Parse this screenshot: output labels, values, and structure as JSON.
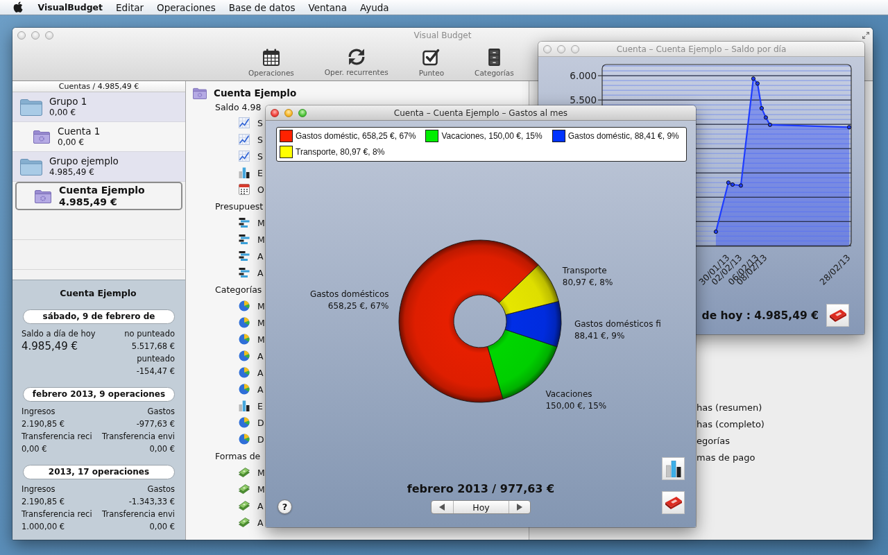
{
  "menu_bar": {
    "app_name": "VisualBudget",
    "items": [
      "Editar",
      "Operaciones",
      "Base de datos",
      "Ventana",
      "Ayuda"
    ]
  },
  "main_window": {
    "title": "Visual Budget",
    "active": false,
    "toolbar": [
      {
        "label": "Operaciones",
        "kind": "calendar"
      },
      {
        "label": "Oper. recurrentes",
        "kind": "repeat"
      },
      {
        "label": "Punteo",
        "kind": "check"
      },
      {
        "label": "Categorías",
        "kind": "cabinet"
      }
    ],
    "sidebar": {
      "header": "Cuentas / 4.985,49 €",
      "tree": [
        {
          "kind": "group",
          "name": "Grupo 1",
          "amount": "0,00 €",
          "selected": false,
          "children": [
            {
              "kind": "account",
              "name": "Cuenta 1",
              "amount": "0,00 €",
              "selected": false
            }
          ]
        },
        {
          "kind": "group",
          "name": "Grupo ejemplo",
          "amount": "4.985,49 €",
          "selected": false,
          "children": [
            {
              "kind": "account",
              "name": "Cuenta Ejemplo",
              "amount": "4.985,49 €",
              "selected": true
            }
          ]
        }
      ],
      "summary": {
        "title": "Cuenta Ejemplo",
        "sections": [
          {
            "kind": "balance",
            "heading": "sábado, 9 de febrero de",
            "label": "Saldo a día de hoy",
            "value": "4.985,49 €",
            "figures": [
              {
                "label": "no punteado",
                "value": "5.517,68 €"
              },
              {
                "label": "punteado",
                "value": "-154,47 €"
              }
            ]
          },
          {
            "kind": "totals",
            "heading": "febrero 2013, 9 operaciones",
            "figures": [
              {
                "label": "Ingresos",
                "value": "2.190,85 €"
              },
              {
                "label": "Gastos",
                "value": "-977,63 €"
              },
              {
                "label": "Transferencia reci",
                "value": "0,00 €"
              },
              {
                "label": "Transferencia envi",
                "value": "0,00 €"
              }
            ]
          },
          {
            "kind": "totals",
            "heading": "2013, 17 operaciones",
            "figures": [
              {
                "label": "Ingresos",
                "value": "2.190,85 €"
              },
              {
                "label": "Gastos",
                "value": "-1.343,33 €"
              },
              {
                "label": "Transferencia reci",
                "value": "1.000,00 €"
              },
              {
                "label": "Transferencia envi",
                "value": "0,00 €"
              }
            ]
          }
        ]
      }
    },
    "detail": {
      "title": "Cuenta Ejemplo",
      "balance": "Saldo 4.98",
      "items": [
        {
          "kind": "line-chart",
          "label": "S"
        },
        {
          "kind": "line-chart",
          "label": "S"
        },
        {
          "kind": "line-chart",
          "label": "S"
        },
        {
          "kind": "bar-chart",
          "label": "E"
        },
        {
          "kind": "calendar",
          "label": "O"
        }
      ],
      "sections": [
        {
          "heading": "Presupuest",
          "items": [
            {
              "kind": "budget",
              "label": "M"
            },
            {
              "kind": "budget",
              "label": "M"
            },
            {
              "kind": "budget",
              "label": "A"
            },
            {
              "kind": "budget",
              "label": "A"
            }
          ]
        },
        {
          "heading": "Categorías",
          "items": [
            {
              "kind": "pie",
              "label": "M"
            },
            {
              "kind": "pie",
              "label": "M"
            },
            {
              "kind": "pie",
              "label": "M"
            },
            {
              "kind": "pie",
              "label": "A"
            },
            {
              "kind": "pie",
              "label": "A"
            },
            {
              "kind": "pie",
              "label": "A"
            },
            {
              "kind": "bar-chart",
              "label": "E"
            },
            {
              "kind": "pie",
              "label": "D"
            },
            {
              "kind": "pie",
              "label": "D"
            }
          ]
        },
        {
          "heading": "Formas de",
          "items": [
            {
              "kind": "money",
              "label": "M"
            },
            {
              "kind": "money",
              "label": "M"
            },
            {
              "kind": "money",
              "label": "A"
            },
            {
              "kind": "money",
              "label": "A"
            }
          ]
        }
      ]
    },
    "reports": {
      "items": [
        "has (resumen)",
        "has (completo)",
        "egorías",
        "mas de pago"
      ]
    }
  },
  "chart_window": {
    "title": "Cuenta – Cuenta Ejemplo – Saldo por día",
    "active": false,
    "chart_data": {
      "type": "area",
      "categories": [
        null,
        null,
        null,
        null,
        null,
        null,
        null,
        null,
        null,
        null,
        null,
        null,
        null,
        null,
        null,
        null,
        null,
        null,
        null,
        null,
        null,
        null,
        null,
        null,
        null,
        null,
        null,
        null,
        null,
        null,
        "30/01/13",
        null,
        null,
        "02/02/13",
        null,
        null,
        null,
        "06/02/13",
        null,
        "08/02/13",
        null,
        null,
        null,
        null,
        null,
        null,
        null,
        null,
        null,
        null,
        null,
        null,
        null,
        null,
        null,
        null,
        null,
        null,
        null,
        "28/02/13"
      ],
      "series": [
        {
          "color": "#1f3dff",
          "values": [
            null,
            null,
            null,
            null,
            null,
            null,
            null,
            null,
            null,
            null,
            null,
            null,
            null,
            null,
            null,
            null,
            null,
            null,
            null,
            null,
            null,
            null,
            null,
            null,
            null,
            null,
            null,
            2790,
            null,
            null,
            3800,
            3760,
            null,
            3740,
            null,
            null,
            5940,
            5840,
            5330,
            5140,
            4990,
            null,
            null,
            null,
            null,
            null,
            null,
            null,
            null,
            null,
            null,
            null,
            null,
            null,
            null,
            null,
            null,
            null,
            null,
            4940
          ]
        }
      ],
      "ylim": [
        2490,
        6230
      ],
      "yticks": [
        {
          "value": 6000,
          "label": "6.000"
        },
        {
          "value": 5500,
          "label": "5.500"
        }
      ],
      "grid": true
    },
    "footer": "de hoy : 4.985,49 €"
  },
  "pie_window": {
    "title": "Cuenta – Cuenta Ejemplo – Gastos al mes",
    "active": true,
    "legend": [
      {
        "label": "Gastos doméstic, 658,25 €, 67%",
        "color": "#ff2200"
      },
      {
        "label": "Vacaciones, 150,00 €, 15%",
        "color": "#00ee00"
      },
      {
        "label": "Gastos doméstic, 88,41 €, 9%",
        "color": "#0033ff"
      },
      {
        "label": "Transporte, 80,97 €, 8%",
        "color": "#ffff00"
      }
    ],
    "chart_data": {
      "type": "donut",
      "categories": [
        "Gastos domésticos",
        "Vacaciones",
        "Gastos domésticos fi",
        "Transporte"
      ],
      "values": [
        658.25,
        150.0,
        88.41,
        80.97
      ],
      "value_labels": [
        "658,25 €, 67%",
        "150,00 €, 15%",
        "88,41 €, 9%",
        "80,97 €, 8%"
      ]
    },
    "period": "febrero 2013 / 977,63 €",
    "navigator": {
      "today": "Hoy"
    },
    "help": "?"
  }
}
